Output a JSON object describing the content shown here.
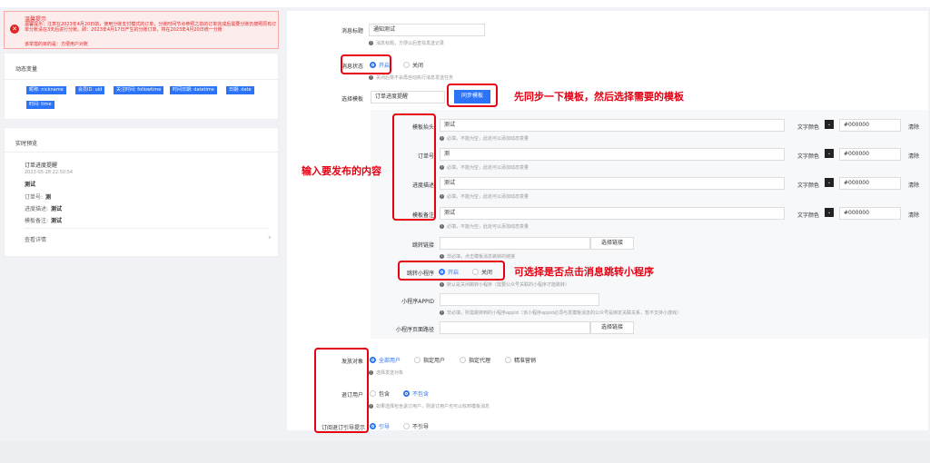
{
  "alert": {
    "title": "温馨提示",
    "text": "温馨提示：注意在2023年4月20日前，使用分账支付模式的订单，分账时间节点参照之前的订单完成后需要分账仍按照原有订单分账请在3天后进行分账。即：2023年4月17日产生的分账订单，将在2023年4月20日统一分账",
    "note": "该举措的目的是：方便用户对账"
  },
  "vars": {
    "title": "动态变量",
    "tags": [
      "昵称: nickname",
      "会员ID: uid",
      "关注时间: followtime",
      "时间日期: datetime",
      "日期: date",
      "时间: time"
    ]
  },
  "preview": {
    "title": "实时预览",
    "msg_title": "订单进度提醒",
    "datetime": "2023-05-28 22:50:54",
    "heading": "测试",
    "rows": [
      {
        "label": "订单号:",
        "value": "测"
      },
      {
        "label": "进度描述:",
        "value": "测试"
      },
      {
        "label": "模板备注:",
        "value": "测试"
      }
    ],
    "details": "查看详情",
    "chevron": "›"
  },
  "form": {
    "msg_title_label": "消息标题",
    "msg_title_value": "通知测试",
    "msg_title_hint": "消息标题，方便以后查找发送记录",
    "status_label": "消息状态",
    "status_on": "开启",
    "status_off": "关闭",
    "status_hint": "关闭后将不会再自动执行消息发送任务",
    "template_label": "选择模板",
    "template_value": "订单进度提醒",
    "sync_button": "同步模板",
    "field_hint": "必填，不能为空，此处可以添加动态变量",
    "color_label": "文字颜色",
    "clear_label": "清除",
    "fields": [
      {
        "label": "模板抬头",
        "value": "测试",
        "color": "#000000"
      },
      {
        "label": "订单号",
        "value": "测",
        "color": "#000000"
      },
      {
        "label": "进度描述",
        "value": "测试",
        "color": "#000000"
      },
      {
        "label": "模板备注",
        "value": "测试",
        "color": "#000000"
      }
    ],
    "jump_label": "跳转链接",
    "jump_button": "选择链接",
    "jump_hint": "非必填，点击模板消息跳转的链接",
    "mini_label": "跳转小程序",
    "mini_on": "开启",
    "mini_off": "关闭",
    "mini_hint": "默认是关闭跳转小程序（需要公众号关联的小程序才能跳转）",
    "appid_label": "小程序APPID",
    "appid_hint": "非必填，所需跳转到的小程序appid（该小程序appid必须与发模板消息的公众号是绑定关联关系，暂不支持小游戏）",
    "page_label": "小程序页面路径",
    "page_button": "选择链接",
    "target_label": "发放对象",
    "target_options": [
      "全部用户",
      "指定用户",
      "指定代理",
      "精准营销"
    ],
    "target_hint": "选择发送对象",
    "sub_label": "退订用户",
    "sub_options": [
      "包含",
      "不包含"
    ],
    "sub_hint": "如果选择包含退订用户，则退订用户也可以收到模板消息",
    "guide_label": "订阅退订引导提示",
    "guide_options": [
      "引导",
      "不引导"
    ]
  },
  "annotations": {
    "sync": "先同步一下模板，然后选择需要的模板",
    "content": "输入要发布的内容",
    "mini": "可选择是否点击消息跳转小程序"
  },
  "colors": {
    "accent": "#2d73f5",
    "annotation": "#e60012"
  },
  "icons": {
    "alert": "close-circle-icon",
    "info": "info-icon"
  }
}
